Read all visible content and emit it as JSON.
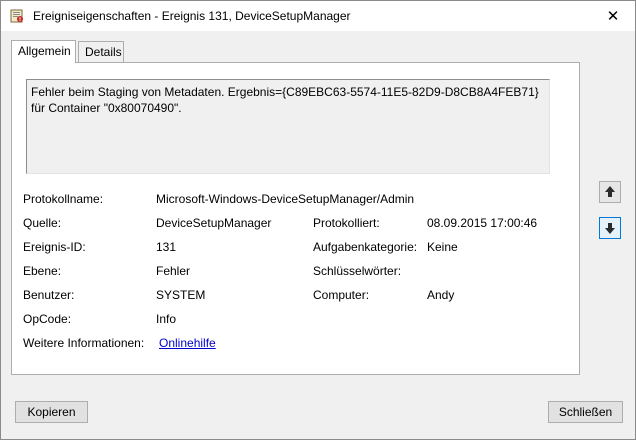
{
  "window": {
    "title": "Ereigniseigenschaften - Ereignis 131, DeviceSetupManager",
    "close_glyph": "✕"
  },
  "tabs": [
    {
      "label": "Allgemein",
      "active": true
    },
    {
      "label": "Details",
      "active": false
    }
  ],
  "event": {
    "description": "Fehler beim Staging von Metadaten. Ergebnis={C89EBC63-5574-11E5-82D9-D8CB8A4FEB71} für Container \"0x80070490\".",
    "fields": {
      "log_name": {
        "label": "Protokollname:",
        "value": "Microsoft-Windows-DeviceSetupManager/Admin"
      },
      "source": {
        "label": "Quelle:",
        "value": "DeviceSetupManager"
      },
      "logged": {
        "label": "Protokolliert:",
        "value": "08.09.2015 17:00:46"
      },
      "event_id": {
        "label": "Ereignis-ID:",
        "value": "131"
      },
      "task_category": {
        "label": "Aufgabenkategorie:",
        "value": "Keine"
      },
      "level": {
        "label": "Ebene:",
        "value": "Fehler"
      },
      "keywords": {
        "label": "Schlüsselwörter:",
        "value": ""
      },
      "user": {
        "label": "Benutzer:",
        "value": "SYSTEM"
      },
      "computer": {
        "label": "Computer:",
        "value": "Andy"
      },
      "opcode": {
        "label": "OpCode:",
        "value": "Info"
      },
      "more_info": {
        "label": "Weitere Informationen:",
        "value": "Onlinehilfe"
      }
    }
  },
  "buttons": {
    "copy": "Kopieren",
    "close": "Schließen"
  },
  "icons": {
    "app": "event-viewer-icon",
    "up": "arrow-up-icon",
    "down": "arrow-down-icon"
  },
  "colors": {
    "link": "#0000cc",
    "focus": "#0078d7"
  }
}
